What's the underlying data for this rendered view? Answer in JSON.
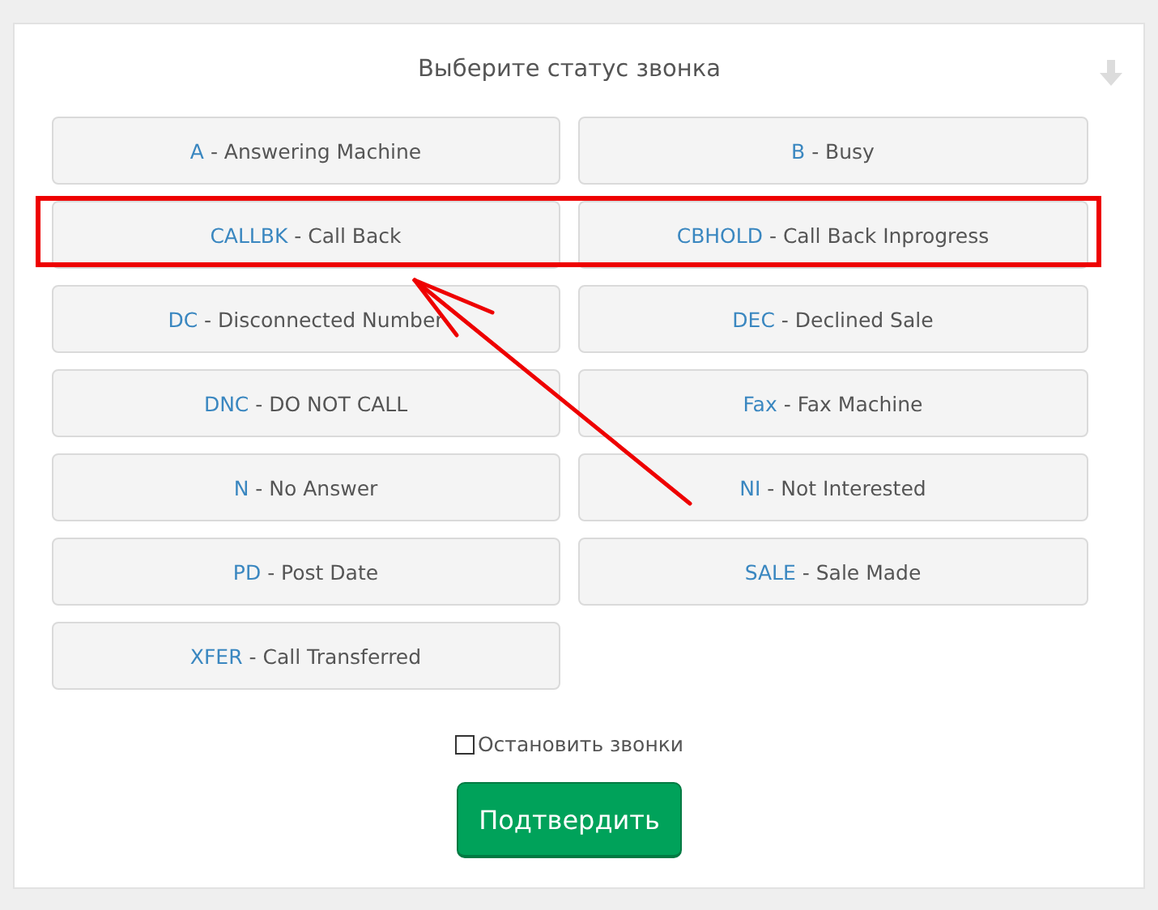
{
  "title": "Выберите статус звонка",
  "statuses": [
    {
      "code": "A",
      "label": "Answering Machine",
      "highlighted": false
    },
    {
      "code": "B",
      "label": "Busy",
      "highlighted": false
    },
    {
      "code": "CALLBK",
      "label": "Call Back",
      "highlighted": true
    },
    {
      "code": "CBHOLD",
      "label": "Call Back Inprogress",
      "highlighted": true
    },
    {
      "code": "DC",
      "label": "Disconnected Number",
      "highlighted": false
    },
    {
      "code": "DEC",
      "label": "Declined Sale",
      "highlighted": false
    },
    {
      "code": "DNC",
      "label": "DO NOT CALL",
      "highlighted": false
    },
    {
      "code": "Fax",
      "label": "Fax Machine",
      "highlighted": false
    },
    {
      "code": "N",
      "label": "No Answer",
      "highlighted": false
    },
    {
      "code": "NI",
      "label": "Not Interested",
      "highlighted": false
    },
    {
      "code": "PD",
      "label": "Post Date",
      "highlighted": false
    },
    {
      "code": "SALE",
      "label": "Sale Made",
      "highlighted": false
    },
    {
      "code": "XFER",
      "label": "Call Transferred",
      "highlighted": false
    }
  ],
  "separator": " - ",
  "stop_calls": {
    "label": "Остановить звонки",
    "checked": false
  },
  "submit": "Подтвердить",
  "annotation_arrow": true
}
